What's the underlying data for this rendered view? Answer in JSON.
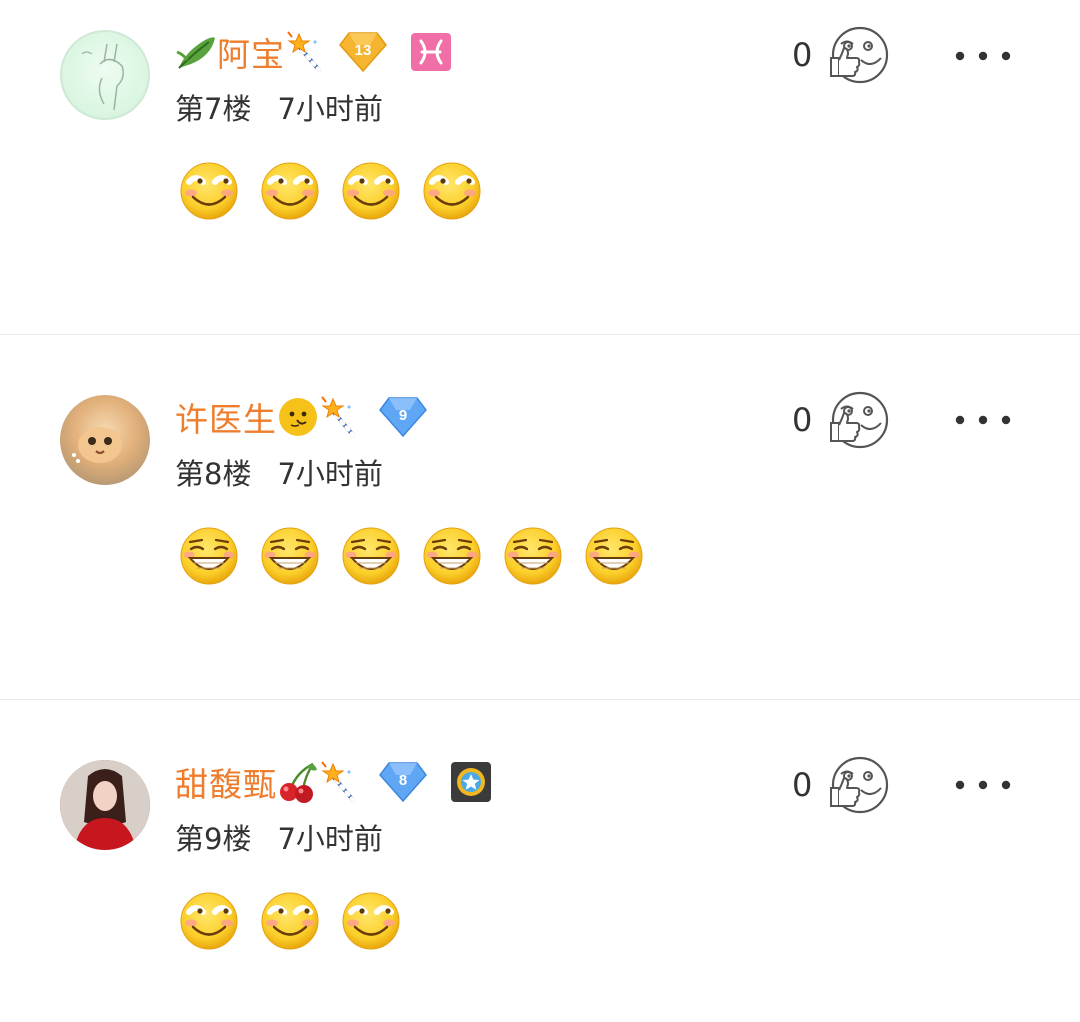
{
  "comments": [
    {
      "username": "阿宝",
      "floor": "第7楼",
      "time": "7小时前",
      "likes": "0",
      "level": "13",
      "reaction_count": 4,
      "reaction": "smile-emoji"
    },
    {
      "username": "许医生",
      "floor": "第8楼",
      "time": "7小时前",
      "likes": "0",
      "level": "9",
      "reaction_count": 6,
      "reaction": "grin-emoji"
    },
    {
      "username": "甜馥甄",
      "floor": "第9楼",
      "time": "7小时前",
      "likes": "0",
      "level": "8",
      "reaction_count": 3,
      "reaction": "smile-emoji"
    }
  ],
  "colors": {
    "username": "#ee7d2d",
    "text": "#333333",
    "divider": "#ebebeb"
  }
}
